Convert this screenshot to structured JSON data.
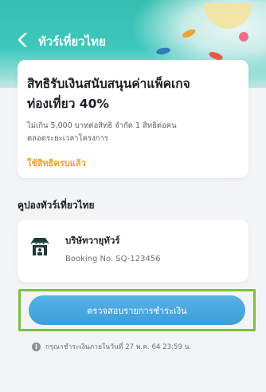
{
  "header": {
    "title": "ทัวร์เที่ยวไทย",
    "back_icon": "chevron-left-icon"
  },
  "privilege": {
    "headline_line1": "สิทธิรับเงินสนับสนุนค่าแพ็คเกจ",
    "headline_line2": "ท่องเที่ยว 40%",
    "desc_line1": "ไม่เกิน 5,000 บาทต่อสิทธิ จำกัด 1 สิทธิต่อคน",
    "desc_line2": "ตลอดระยะเวลาโครงการ",
    "status": "ใช้สิทธิครบแล้ว"
  },
  "coupon": {
    "section_title": "คูปองทัวร์เที่ยวไทย",
    "company_name": "บริษัทวายุทัวร์",
    "booking_no": "Booking No. SQ-123456",
    "company_icon": "shop-icon"
  },
  "action": {
    "pay_button_label": "ตรวจสอบรายการชำระเงิน"
  },
  "notice": {
    "text": "กรุณาชำระเงินภายในวันที่ 27 พ.ค. 64 23:59 น.",
    "icon": "info-icon"
  },
  "colors": {
    "header_teal": "#3ec8bd",
    "accent_orange": "#f0a31e",
    "button_blue": "#3d9edb",
    "highlight_green": "#7cc043"
  }
}
